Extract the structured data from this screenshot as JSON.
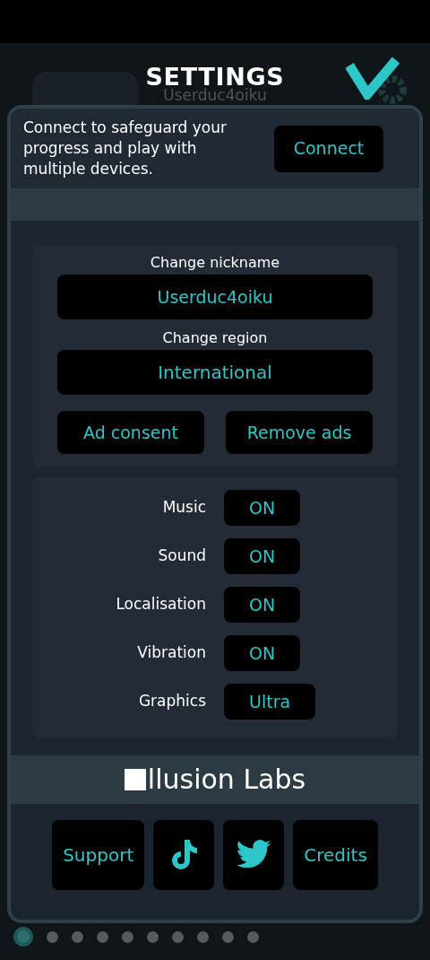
{
  "header": {
    "title": "SETTINGS",
    "username": "Userduc4oiku"
  },
  "connect": {
    "message": "Connect to safeguard your progress and play with multiple devices.",
    "button": "Connect"
  },
  "profile": {
    "nickname_label": "Change nickname",
    "nickname": "Userduc4oiku",
    "region_label": "Change region",
    "region": "International",
    "buttons": [
      "Ad consent",
      "Remove ads"
    ]
  },
  "options": [
    {
      "label": "Music",
      "value": "ON"
    },
    {
      "label": "Sound",
      "value": "ON"
    },
    {
      "label": "Localisation",
      "value": "ON"
    },
    {
      "label": "Vibration",
      "value": "ON"
    },
    {
      "label": "Graphics",
      "value": "Ultra"
    }
  ],
  "brand": {
    "name": "llusion Labs"
  },
  "links": [
    {
      "kind": "text",
      "label": "Support"
    },
    {
      "kind": "tiktok"
    },
    {
      "kind": "twitter"
    },
    {
      "kind": "text",
      "label": "Credits"
    }
  ],
  "pages": [
    {
      "selected": true
    },
    {
      "selected": false
    },
    {
      "selected": false
    },
    {
      "selected": false
    },
    {
      "selected": false
    },
    {
      "selected": false
    },
    {
      "selected": false
    },
    {
      "selected": false
    },
    {
      "selected": false
    },
    {
      "selected": false
    }
  ]
}
